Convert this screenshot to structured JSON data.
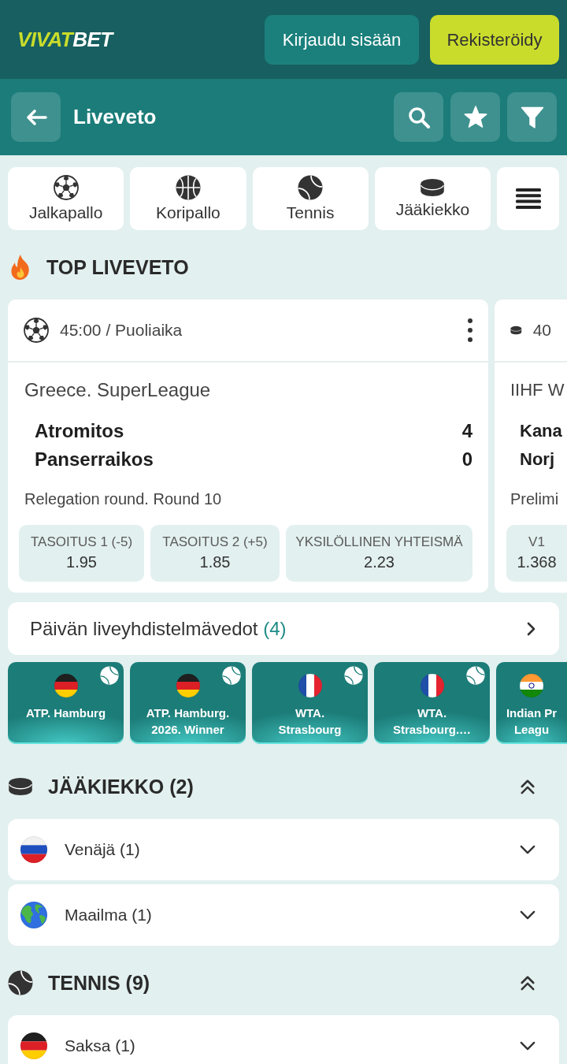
{
  "header": {
    "logo": {
      "accent": "VIVAT",
      "rest": "BET"
    },
    "login_button": "Kirjaudu sisään",
    "register_button": "Rekisteröidy"
  },
  "subheader": {
    "title": "Liveveto"
  },
  "sports_tabs": [
    {
      "kind": "soccer",
      "label": "Jalkapallo"
    },
    {
      "kind": "basketball",
      "label": "Koripallo"
    },
    {
      "kind": "tennis",
      "label": "Tennis"
    },
    {
      "kind": "hockey",
      "label": "Jääkiekko"
    },
    {
      "kind": "menu"
    }
  ],
  "top_live": {
    "title": "TOP LIVEVETO",
    "matches": [
      {
        "kind": "soccer",
        "time": "45:00 / Puoliaika",
        "menu": true,
        "league": "Greece. SuperLeague",
        "teams": [
          {
            "name": "Atromitos",
            "score": "4"
          },
          {
            "name": "Panserraikos",
            "score": "0"
          }
        ],
        "round": "Relegation round. Round 10",
        "odds": [
          {
            "label": "TASOITUS 1 (-5)",
            "value": "1.95"
          },
          {
            "label": "TASOITUS 2 (+5)",
            "value": "1.85"
          },
          {
            "label": "YKSILÖLLINEN YHTEISMÄ",
            "value": "2.23"
          }
        ]
      },
      {
        "kind": "hockey",
        "time": "40",
        "league": "IIHF W",
        "teams": [
          {
            "name": "Kana"
          },
          {
            "name": "Norj"
          }
        ],
        "round": "Prelimi",
        "odds": [
          {
            "label": "V1",
            "value": "1.368"
          }
        ]
      }
    ]
  },
  "combo_link": {
    "label": "Päivän liveyhdistelmävedot",
    "count": "(4)"
  },
  "tournaments": [
    {
      "kind": "germany",
      "lines": [
        "ATP. Hamburg"
      ]
    },
    {
      "kind": "germany",
      "lines": [
        "ATP. Hamburg.",
        "2026. Winner"
      ]
    },
    {
      "kind": "france",
      "lines": [
        "WTA.",
        "Strasbourg"
      ]
    },
    {
      "kind": "france",
      "lines": [
        "WTA.",
        "Strasbourg.…"
      ]
    },
    {
      "kind": "india",
      "lines": [
        "Indian Pr",
        "Leagu"
      ]
    }
  ],
  "sections": [
    {
      "kind": "hockey",
      "title": "JÄÄKIEKKO (2)",
      "expanded": true,
      "items": [
        {
          "kind": "russia",
          "label": "Venäjä (1)",
          "expanded": false
        },
        {
          "kind": "world",
          "label": "Maailma (1)",
          "expanded": false
        }
      ]
    },
    {
      "kind": "tennis",
      "title": "TENNIS (9)",
      "expanded": true,
      "items": [
        {
          "kind": "germany",
          "label": "Saksa (1)",
          "expanded": false
        }
      ]
    }
  ]
}
